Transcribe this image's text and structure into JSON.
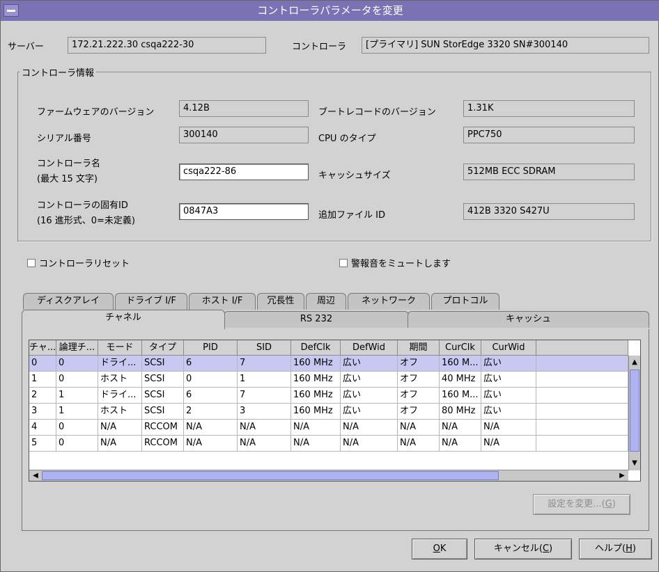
{
  "window": {
    "title": "コントローラパラメータを変更"
  },
  "server": {
    "label": "サーバー",
    "value": "172.21.222.30 csqa222-30"
  },
  "controller": {
    "label": "コントローラ",
    "value": "[プライマリ] SUN StorEdge 3320 SN#300140"
  },
  "info": {
    "group_label": "コントローラ情報",
    "firmware_label": "ファームウェアのバージョン",
    "firmware_value": "4.12B",
    "bootrecord_label": "ブートレコードのバージョン",
    "bootrecord_value": "1.31K",
    "serial_label": "シリアル番号",
    "serial_value": "300140",
    "cpu_label": "CPU のタイプ",
    "cpu_value": "PPC750",
    "name_label_line1": "コントローラ名",
    "name_label_line2": "(最大 15 文字)",
    "name_value": "csqa222-86",
    "cache_label": "キャッシュサイズ",
    "cache_value": "512MB ECC SDRAM",
    "uid_label_line1": "コントローラの固有ID",
    "uid_label_line2": "(16 進形式、0=未定義)",
    "uid_value": "0847A3",
    "fileid_label": "追加ファイル ID",
    "fileid_value": "412B 3320 S427U"
  },
  "options": {
    "reset_label": "コントローラリセット",
    "mute_label": "警報音をミュートします"
  },
  "tabs_row1": [
    "ディスクアレイ",
    "ドライブ I/F",
    "ホスト I/F",
    "冗長性",
    "周辺",
    "ネットワーク",
    "プロトコル"
  ],
  "tabs_row2": [
    "チャネル",
    "RS 232",
    "キャッシュ"
  ],
  "table": {
    "headers": [
      "チャ...",
      "論理チ...",
      "モード",
      "タイプ",
      "PID",
      "SID",
      "DefClk",
      "DefWid",
      "期間",
      "CurClk",
      "CurWid"
    ],
    "rows": [
      [
        "0",
        "0",
        "ドライ...",
        "SCSI",
        "6",
        "7",
        "160 MHz",
        "広い",
        "オフ",
        "160 M...",
        "広い"
      ],
      [
        "1",
        "0",
        "ホスト",
        "SCSI",
        "0",
        "1",
        "160 MHz",
        "広い",
        "オフ",
        "40 MHz",
        "広い"
      ],
      [
        "2",
        "1",
        "ドライ...",
        "SCSI",
        "6",
        "7",
        "160 MHz",
        "広い",
        "オフ",
        "160 M...",
        "広い"
      ],
      [
        "3",
        "1",
        "ホスト",
        "SCSI",
        "2",
        "3",
        "160 MHz",
        "広い",
        "オフ",
        "80 MHz",
        "広い"
      ],
      [
        "4",
        "0",
        "N/A",
        "RCCOM",
        "N/A",
        "N/A",
        "N/A",
        "N/A",
        "N/A",
        "N/A",
        "N/A"
      ],
      [
        "5",
        "0",
        "N/A",
        "RCCOM",
        "N/A",
        "N/A",
        "N/A",
        "N/A",
        "N/A",
        "N/A",
        "N/A"
      ]
    ]
  },
  "buttons": {
    "change_settings_text": "設定を変更...(",
    "change_settings_key": "G",
    "ok_key": "O",
    "ok_text": "K",
    "cancel_text": "キャンセル(",
    "cancel_key": "C",
    "help_text": "ヘルプ(",
    "help_key": "H",
    "close_paren": ")"
  }
}
